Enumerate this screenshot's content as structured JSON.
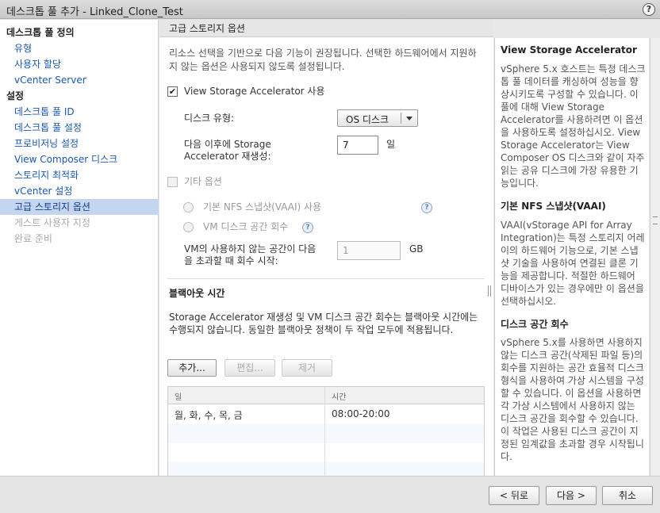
{
  "window": {
    "title": "데스크톱 풀 추가 - Linked_Clone_Test",
    "help_label": "?"
  },
  "nav": {
    "items": [
      {
        "label": "데스크톱 풀 정의",
        "type": "head"
      },
      {
        "label": "유형",
        "type": "link"
      },
      {
        "label": "사용자 할당",
        "type": "link"
      },
      {
        "label": "vCenter Server",
        "type": "link"
      },
      {
        "label": "설정",
        "type": "head"
      },
      {
        "label": "데스크톱 풀 ID",
        "type": "link"
      },
      {
        "label": "데스크톱 풀 설정",
        "type": "link"
      },
      {
        "label": "프로비저닝 설정",
        "type": "link"
      },
      {
        "label": "View Composer 디스크",
        "type": "link"
      },
      {
        "label": "스토리지 최적화",
        "type": "link"
      },
      {
        "label": "vCenter 설정",
        "type": "link"
      },
      {
        "label": "고급 스토리지 옵션",
        "type": "active"
      },
      {
        "label": "게스트 사용자 지정",
        "type": "disabled"
      },
      {
        "label": "완료 준비",
        "type": "disabled"
      }
    ]
  },
  "main": {
    "header": "고급 스토리지 옵션",
    "intro": "리소스 선택을 기반으로 다음 기능이 권장됩니다. 선택한 하드웨어에서 지원하지 않는 옵션은 사용되지 않도록 설정됩니다.",
    "vsa": {
      "checkbox_label": "View Storage Accelerator 사용",
      "checked": true,
      "check_mark": "✔",
      "disk_type_label": "디스크 유형:",
      "disk_type_value": "OS 디스크",
      "regen_label_line1": "다음 이후에 Storage",
      "regen_label_line2": "Accelerator 재생성:",
      "regen_value": "7",
      "regen_unit": "일"
    },
    "other": {
      "checkbox_label": "기타 옵션",
      "checked": false,
      "nfs_label": "기본 NFS 스냅샷(VAAI) 사용",
      "reclaim_label": "VM 디스크 공간 회수",
      "threshold_line1": "VM의 사용하지 않는 공간이 다음",
      "threshold_line2": "을 초과할 때 회수 시작:",
      "threshold_value": "1",
      "threshold_unit": "GB",
      "help_glyph": "?"
    },
    "blackout": {
      "title": "블랙아웃 시간",
      "desc": "Storage Accelerator 재생성 및 VM 디스크 공간 회수는 블랙아웃 시간에는 수행되지 않습니다. 동일한 블랙아웃 정책이 두 작업 모두에 적용됩니다.",
      "add_label": "추가...",
      "edit_label": "편집...",
      "remove_label": "제거",
      "columns": [
        "일",
        "시간"
      ],
      "rows": [
        {
          "day": "월, 화, 수, 목, 금",
          "time": "08:00-20:00"
        }
      ]
    }
  },
  "help": {
    "sections": [
      {
        "title": "View Storage Accelerator",
        "body": "vSphere 5.x 호스트는 특정 데스크톱 풀 데이터를 캐싱하여 성능을 향상시키도록 구성할 수 있습니다. 이 풀에 대해 View Storage Accelerator를 사용하려면 이 옵션을 사용하도록 설정하십시오. View Storage Accelerator는 View Composer OS 디스크와 같이 자주 읽는 공유 디스크에 가장 유용한 기능입니다."
      },
      {
        "title": "기본 NFS 스냅샷(VAAI)",
        "body": "VAAI(vStorage API for Array Integration)는 특정 스토리지 어레이의 하드웨어 기능으로, 기본 스냅샷 기술을 사용하여 연결된 클론 기능을 제공합니다. 적절한 하드웨어 디바이스가 있는 경우에만 이 옵션을 선택하십시오."
      },
      {
        "title": "디스크 공간 회수",
        "body": "vSphere 5.x를 사용하면 사용하지 않는 디스크 공간(삭제된 파일 등)의 회수를 지원하는 공간 효율적 디스크 형식을 사용하여 가상 시스템을 구성할 수 있습니다. 이 옵션을 사용하면 각 가상 시스템에서 사용하지 않는 디스크 공간을 회수할 수 있습니다. 이 작업은 사용된 디스크 공간이 지정된 임계값을 초과할 경우 시작됩니다."
      }
    ]
  },
  "footer": {
    "back_label": "< 뒤로",
    "next_label": "다음 >",
    "cancel_label": "취소"
  }
}
